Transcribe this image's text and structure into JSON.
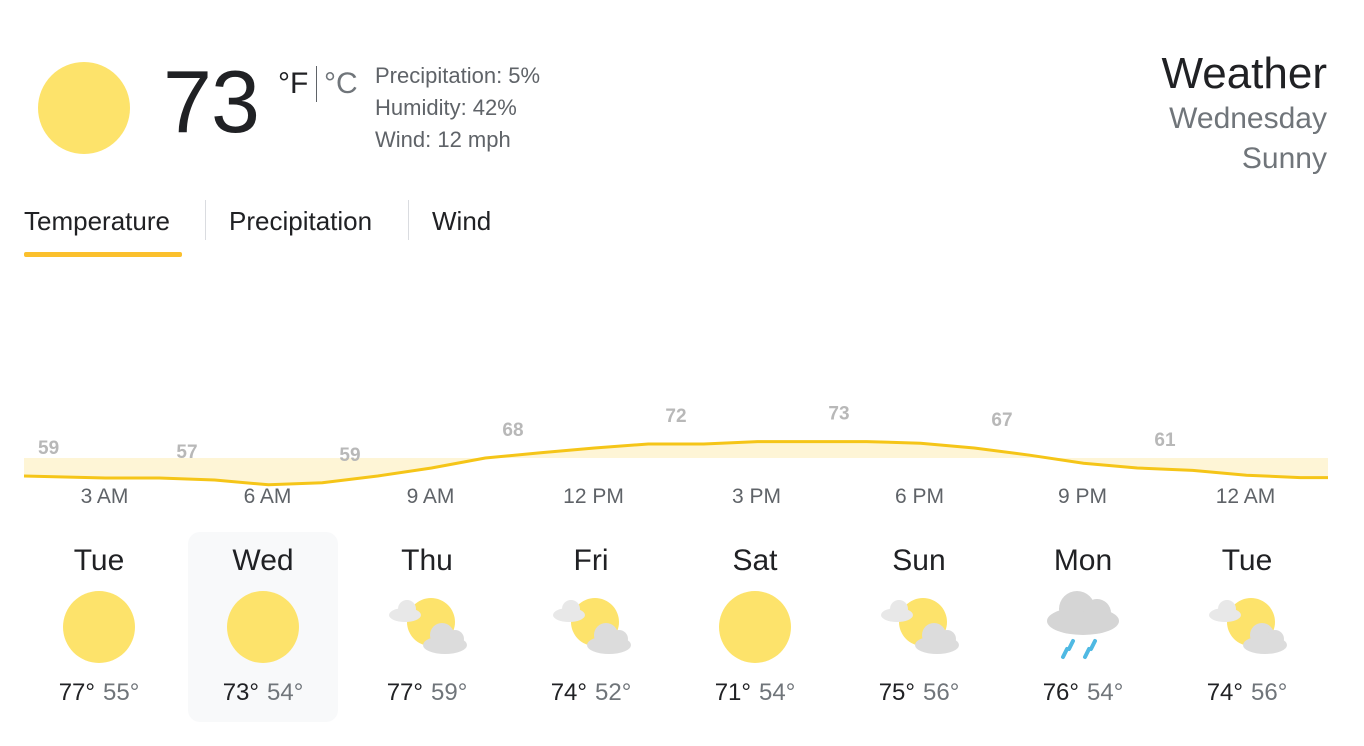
{
  "current": {
    "temperature": "73",
    "unit_f": "°F",
    "unit_c": "°C",
    "precipitation": "Precipitation: 5%",
    "humidity": "Humidity: 42%",
    "wind": "Wind: 12 mph",
    "icon": "sun-icon"
  },
  "header": {
    "title": "Weather",
    "day": "Wednesday",
    "condition": "Sunny"
  },
  "tabs": [
    {
      "label": "Temperature",
      "active": true
    },
    {
      "label": "Precipitation",
      "active": false
    },
    {
      "label": "Wind",
      "active": false
    }
  ],
  "colors": {
    "accent": "#fbc02d",
    "line": "#f5c518",
    "fill": "#fef5d6",
    "sun": "#fde36b"
  },
  "chart_data": {
    "type": "area",
    "unit": "°F",
    "times": [
      "3 AM",
      "6 AM",
      "9 AM",
      "12 PM",
      "3 PM",
      "6 PM",
      "9 PM",
      "12 AM"
    ],
    "labels": [
      {
        "x": 0.5,
        "value": 59
      },
      {
        "x": 1.5,
        "value": 57
      },
      {
        "x": 2.5,
        "value": 59
      },
      {
        "x": 3.5,
        "value": 68
      },
      {
        "x": 4.5,
        "value": 72
      },
      {
        "x": 5.5,
        "value": 73
      },
      {
        "x": 6.5,
        "value": 67
      },
      {
        "x": 7.5,
        "value": 61
      }
    ],
    "series": [
      {
        "values": [
          {
            "x": 0,
            "y": 59
          },
          {
            "x": 0.5,
            "y": 58.5
          },
          {
            "x": 0.83,
            "y": 58.5
          },
          {
            "x": 1.17,
            "y": 58
          },
          {
            "x": 1.5,
            "y": 56.8
          },
          {
            "x": 1.83,
            "y": 57.3
          },
          {
            "x": 2.17,
            "y": 59
          },
          {
            "x": 2.5,
            "y": 61
          },
          {
            "x": 2.83,
            "y": 63.5
          },
          {
            "x": 3.17,
            "y": 64.8
          },
          {
            "x": 3.5,
            "y": 66
          },
          {
            "x": 3.83,
            "y": 67
          },
          {
            "x": 4.17,
            "y": 67
          },
          {
            "x": 4.5,
            "y": 67.6
          },
          {
            "x": 4.83,
            "y": 67.6
          },
          {
            "x": 5.17,
            "y": 67.6
          },
          {
            "x": 5.5,
            "y": 67.2
          },
          {
            "x": 5.83,
            "y": 66
          },
          {
            "x": 6.17,
            "y": 64.2
          },
          {
            "x": 6.5,
            "y": 62.2
          },
          {
            "x": 6.83,
            "y": 61
          },
          {
            "x": 7.17,
            "y": 60.4
          },
          {
            "x": 7.5,
            "y": 59.2
          },
          {
            "x": 7.83,
            "y": 58.6
          },
          {
            "x": 8,
            "y": 58.6
          }
        ]
      }
    ],
    "ylim": [
      50,
      80
    ],
    "xlim": [
      0,
      8
    ]
  },
  "forecast": [
    {
      "day": "Tue",
      "icon": "sun-icon",
      "hi": "77°",
      "lo": "55°",
      "selected": false
    },
    {
      "day": "Wed",
      "icon": "sun-icon",
      "hi": "73°",
      "lo": "54°",
      "selected": true
    },
    {
      "day": "Thu",
      "icon": "partly-cloudy-icon",
      "hi": "77°",
      "lo": "59°",
      "selected": false
    },
    {
      "day": "Fri",
      "icon": "partly-cloudy-icon",
      "hi": "74°",
      "lo": "52°",
      "selected": false
    },
    {
      "day": "Sat",
      "icon": "sun-icon",
      "hi": "71°",
      "lo": "54°",
      "selected": false
    },
    {
      "day": "Sun",
      "icon": "partly-cloudy-icon",
      "hi": "75°",
      "lo": "56°",
      "selected": false
    },
    {
      "day": "Mon",
      "icon": "rain-icon",
      "hi": "76°",
      "lo": "54°",
      "selected": false
    },
    {
      "day": "Tue",
      "icon": "partly-cloudy-icon",
      "hi": "74°",
      "lo": "56°",
      "selected": false
    }
  ]
}
